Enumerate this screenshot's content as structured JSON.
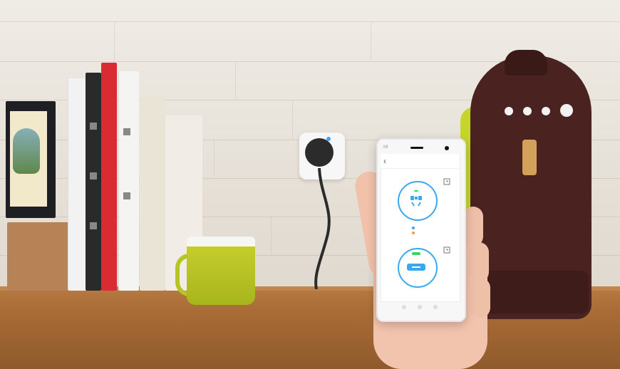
{
  "scene": {
    "phone": {
      "brand": "MI",
      "back_glyph": "‹",
      "title": "",
      "section1": {
        "timer_icon": "timer-icon"
      },
      "section2": {
        "timer_icon": "timer-icon"
      }
    }
  },
  "colors": {
    "accent_blue": "#3aa8f0",
    "plug_light": "#38a4ff"
  }
}
